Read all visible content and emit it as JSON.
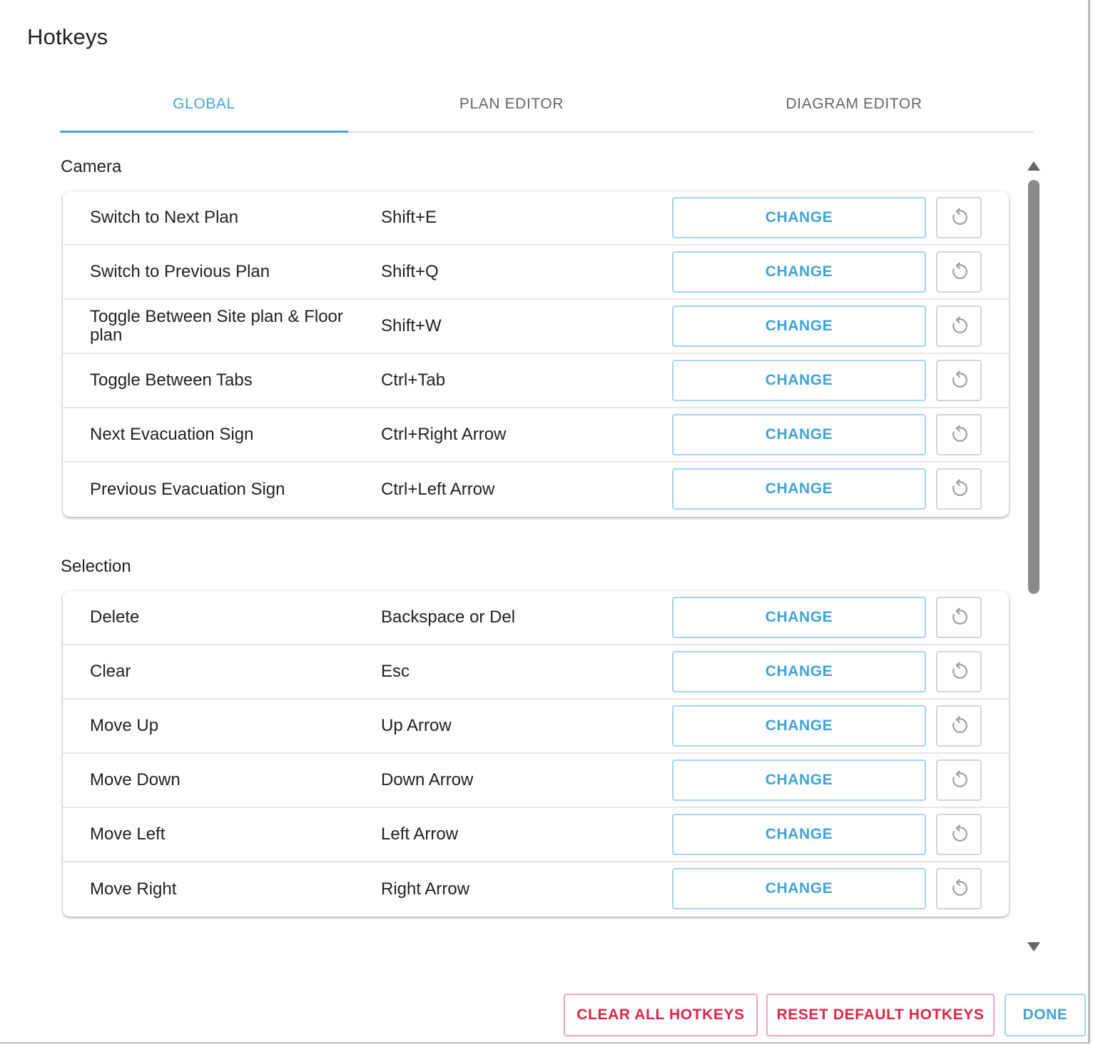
{
  "dialog": {
    "title": "Hotkeys"
  },
  "tabs": [
    {
      "label": "GLOBAL",
      "active": true
    },
    {
      "label": "PLAN EDITOR",
      "active": false
    },
    {
      "label": "DIAGRAM EDITOR",
      "active": false
    }
  ],
  "sections": [
    {
      "title": "Camera",
      "rows": [
        {
          "action": "Switch to Next Plan",
          "hotkey": "Shift+E",
          "change_label": "CHANGE"
        },
        {
          "action": "Switch to Previous Plan",
          "hotkey": "Shift+Q",
          "change_label": "CHANGE"
        },
        {
          "action": "Toggle Between Site plan & Floor plan",
          "hotkey": "Shift+W",
          "change_label": "CHANGE"
        },
        {
          "action": "Toggle Between Tabs",
          "hotkey": "Ctrl+Tab",
          "change_label": "CHANGE"
        },
        {
          "action": "Next Evacuation Sign",
          "hotkey": "Ctrl+Right Arrow",
          "change_label": "CHANGE"
        },
        {
          "action": "Previous Evacuation Sign",
          "hotkey": "Ctrl+Left Arrow",
          "change_label": "CHANGE"
        }
      ]
    },
    {
      "title": "Selection",
      "rows": [
        {
          "action": "Delete",
          "hotkey": "Backspace or Del",
          "change_label": "CHANGE"
        },
        {
          "action": "Clear",
          "hotkey": "Esc",
          "change_label": "CHANGE"
        },
        {
          "action": "Move Up",
          "hotkey": "Up Arrow",
          "change_label": "CHANGE"
        },
        {
          "action": "Move Down",
          "hotkey": "Down Arrow",
          "change_label": "CHANGE"
        },
        {
          "action": "Move Left",
          "hotkey": "Left Arrow",
          "change_label": "CHANGE"
        },
        {
          "action": "Move Right",
          "hotkey": "Right Arrow",
          "change_label": "CHANGE"
        }
      ]
    }
  ],
  "footer": {
    "clear_all_label": "CLEAR ALL HOTKEYS",
    "reset_default_label": "RESET DEFAULT HOTKEYS",
    "done_label": "DONE"
  },
  "icons": {
    "reset": "reset-icon",
    "scroll_up": "arrow-up-icon",
    "scroll_down": "arrow-down-icon"
  },
  "colors": {
    "accent": "#3fa3d6",
    "danger": "#e0244a",
    "reset_icon": "#9e9e9e"
  }
}
